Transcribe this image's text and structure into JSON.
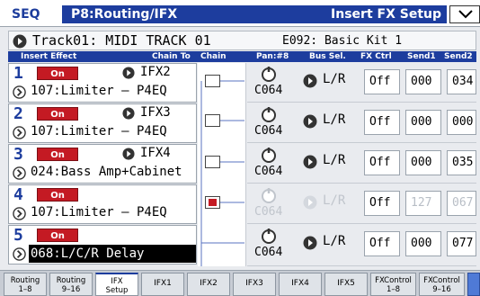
{
  "header": {
    "mode": "SEQ",
    "page": "P8:Routing/IFX",
    "section": "Insert FX Setup"
  },
  "track": {
    "name": "Track01: MIDI TRACK 01",
    "program": "E092: Basic Kit 1"
  },
  "columns": {
    "insert_effect": "Insert Effect",
    "chain_to": "Chain To",
    "chain": "Chain",
    "pan": "Pan:#8",
    "bus_sel": "Bus Sel.",
    "fx_ctrl": "FX Ctrl",
    "send1": "Send1",
    "send2": "Send2"
  },
  "slots": [
    {
      "num": "1",
      "on": "On",
      "chain_to": "IFX2",
      "fx": "107:Limiter – P4EQ",
      "chain": false,
      "pan": "C064",
      "bus": "L/R",
      "fx_ctrl": "Off",
      "send1": "000",
      "send2": "034",
      "enabled": true
    },
    {
      "num": "2",
      "on": "On",
      "chain_to": "IFX3",
      "fx": "107:Limiter – P4EQ",
      "chain": false,
      "pan": "C064",
      "bus": "L/R",
      "fx_ctrl": "Off",
      "send1": "000",
      "send2": "000",
      "enabled": true
    },
    {
      "num": "3",
      "on": "On",
      "chain_to": "IFX4",
      "fx": "024:Bass Amp+Cabinet",
      "chain": false,
      "pan": "C064",
      "bus": "L/R",
      "fx_ctrl": "Off",
      "send1": "000",
      "send2": "035",
      "enabled": true
    },
    {
      "num": "4",
      "on": "On",
      "chain_to": "",
      "fx": "107:Limiter – P4EQ",
      "chain": true,
      "pan": "C064",
      "bus": "L/R",
      "fx_ctrl": "Off",
      "send1": "127",
      "send2": "067",
      "enabled": false
    },
    {
      "num": "5",
      "on": "On",
      "chain_to": "",
      "fx": "068:L/C/R Delay",
      "chain": false,
      "pan": "C064",
      "bus": "L/R",
      "fx_ctrl": "Off",
      "send1": "000",
      "send2": "077",
      "enabled": true,
      "selected": true
    }
  ],
  "tabs": [
    {
      "l1": "Routing",
      "l2": "1–8"
    },
    {
      "l1": "Routing",
      "l2": "9–16"
    },
    {
      "l1": "IFX",
      "l2": "Setup",
      "active": true
    },
    {
      "l1": "IFX1"
    },
    {
      "l1": "IFX2"
    },
    {
      "l1": "IFX3"
    },
    {
      "l1": "IFX4"
    },
    {
      "l1": "IFX5"
    },
    {
      "l1": "FXControl",
      "l2": "1–8"
    },
    {
      "l1": "FXControl",
      "l2": "9–16"
    }
  ],
  "colors": {
    "accent": "#1d3d9e",
    "on_button": "#c41a23",
    "background": "#e9ebef"
  }
}
